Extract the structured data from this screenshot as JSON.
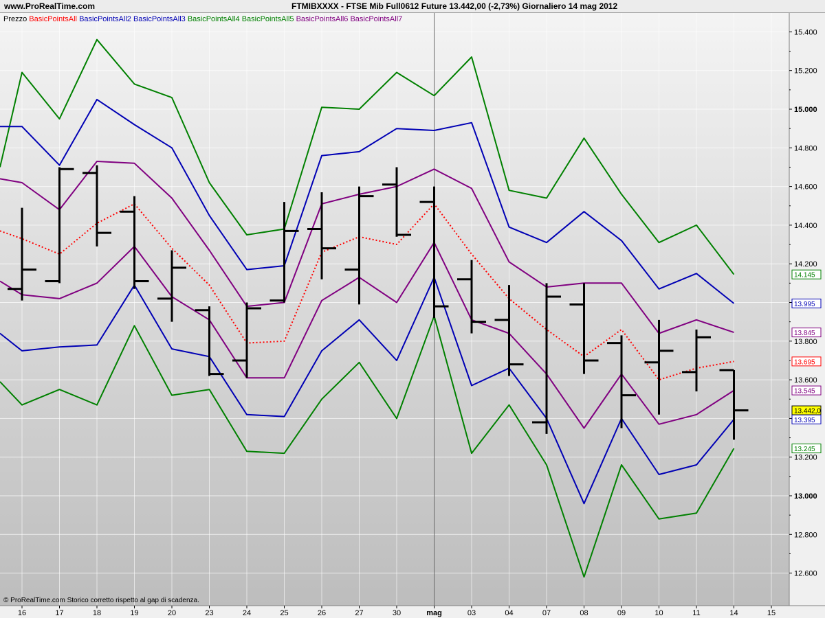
{
  "header": {
    "site": "www.ProRealTime.com",
    "title": "FTMIBXXXX - FTSE Mib Full0612 Future    13.442,00 (-2,73%)    Giornaliero  14 mag 2012"
  },
  "footer": {
    "copyright": "© ProRealTime.com  Storico corretto rispetto al gap di scadenza."
  },
  "chart_data": {
    "type": "line",
    "categories": [
      "16",
      "17",
      "18",
      "19",
      "20",
      "23",
      "24",
      "25",
      "26",
      "27",
      "30",
      "mag",
      "03",
      "04",
      "07",
      "08",
      "09",
      "10",
      "11",
      "14",
      "15"
    ],
    "ylim": [
      12500,
      15500
    ],
    "yticks": [
      12600,
      12800,
      13000,
      13200,
      13400,
      13600,
      13800,
      14000,
      14200,
      14400,
      14600,
      14800,
      15000,
      15200,
      15400
    ],
    "ytick_labels": [
      "12.600",
      "12.800",
      "13.000",
      "13.200",
      "13.400",
      "13.600",
      "13.800",
      "14.000",
      "14.200",
      "14.400",
      "14.600",
      "14.800",
      "15.000",
      "15.200",
      "15.400"
    ],
    "major_ticks": [
      13000,
      15000
    ],
    "grid": true,
    "legend": [
      "Prezzo",
      "BasicPointsAll",
      "BasicPointsAll2",
      "BasicPointsAll3",
      "BasicPointsAll4",
      "BasicPointsAll5",
      "BasicPointsAll6",
      "BasicPointsAll7"
    ],
    "ohlc": {
      "x": [
        "16",
        "17",
        "18",
        "19",
        "20",
        "23",
        "24",
        "25",
        "26",
        "27",
        "30",
        "mag",
        "03",
        "04",
        "07",
        "08",
        "09",
        "10",
        "11",
        "14"
      ],
      "open": [
        14070,
        14110,
        14670,
        14470,
        14020,
        13960,
        13700,
        14010,
        14380,
        14170,
        14610,
        14520,
        14120,
        13910,
        13380,
        13990,
        13790,
        13690,
        13640,
        13650
      ],
      "high": [
        14490,
        14700,
        14710,
        14550,
        14270,
        13980,
        14000,
        14520,
        14570,
        14600,
        14700,
        14600,
        14220,
        14090,
        14100,
        14100,
        13830,
        13910,
        13860,
        13650
      ],
      "low": [
        14010,
        14100,
        14290,
        14070,
        13900,
        13620,
        13610,
        14000,
        14120,
        13990,
        14340,
        13920,
        13840,
        13620,
        13320,
        13630,
        13350,
        13420,
        13540,
        13290
      ],
      "close": [
        14170,
        14690,
        14360,
        14110,
        14180,
        13630,
        13970,
        14370,
        14280,
        14550,
        14350,
        13980,
        13900,
        13680,
        14030,
        13700,
        13520,
        13750,
        13820,
        13442
      ]
    },
    "series": [
      {
        "name": "BasicPointsAll4",
        "color": "#008000",
        "style": "solid",
        "values": [
          15190,
          14950,
          15360,
          15130,
          15060,
          14620,
          14350,
          14380,
          15010,
          15000,
          15190,
          15070,
          15270,
          14580,
          14540,
          14850,
          14560,
          14310,
          14400,
          14145
        ]
      },
      {
        "name": "BasicPointsAll2",
        "color": "#0000b4",
        "style": "solid",
        "values": [
          14910,
          14710,
          15050,
          14920,
          14800,
          14450,
          14170,
          14190,
          14760,
          14780,
          14900,
          14890,
          14930,
          14390,
          14310,
          14470,
          14320,
          14070,
          14150,
          13995
        ]
      },
      {
        "name": "BasicPointsAll6",
        "color": "#800080",
        "style": "solid",
        "values": [
          14620,
          14480,
          14730,
          14720,
          14540,
          14270,
          13980,
          14000,
          14510,
          14560,
          14600,
          14690,
          14590,
          14210,
          14080,
          14100,
          14100,
          13840,
          13910,
          13845
        ]
      },
      {
        "name": "BasicPointsAll",
        "color": "#ff0000",
        "style": "dotted",
        "values": [
          14330,
          14250,
          14410,
          14510,
          14280,
          14090,
          13790,
          13800,
          14260,
          14340,
          14300,
          14510,
          14250,
          14020,
          13860,
          13720,
          13860,
          13600,
          13660,
          13695
        ]
      },
      {
        "name": "BasicPointsAll7",
        "color": "#800080",
        "style": "solid",
        "values": [
          14040,
          14020,
          14100,
          14290,
          14030,
          13910,
          13610,
          13610,
          14010,
          14130,
          14000,
          14310,
          13910,
          13840,
          13630,
          13350,
          13630,
          13370,
          13420,
          13545
        ]
      },
      {
        "name": "BasicPointsAll3",
        "color": "#0000b4",
        "style": "solid",
        "values": [
          13750,
          13770,
          13780,
          14090,
          13760,
          13720,
          13420,
          13410,
          13750,
          13910,
          13700,
          14130,
          13570,
          13660,
          13400,
          12960,
          13400,
          13110,
          13160,
          13395
        ]
      },
      {
        "name": "BasicPointsAll5",
        "color": "#008000",
        "style": "solid",
        "values": [
          13470,
          13550,
          13470,
          13880,
          13520,
          13550,
          13230,
          13220,
          13500,
          13690,
          13400,
          13930,
          13220,
          13470,
          13160,
          12580,
          13160,
          12880,
          12910,
          13245
        ]
      }
    ],
    "first_point": [
      14700,
      14910,
      14640,
      14370,
      14110,
      13840,
      13590
    ],
    "value_badges": [
      {
        "label": "14.145",
        "value": 14145,
        "color": "#008000"
      },
      {
        "label": "13.995",
        "value": 13995,
        "color": "#0000b4"
      },
      {
        "label": "13.845",
        "value": 13845,
        "color": "#800080"
      },
      {
        "label": "13.695",
        "value": 13695,
        "color": "#ff0000"
      },
      {
        "label": "13.545",
        "value": 13545,
        "color": "#800080"
      },
      {
        "label": "13.442,0",
        "value": 13442,
        "color": "#000000",
        "bg": "#ffff00"
      },
      {
        "label": "13.395",
        "value": 13395,
        "color": "#0000b4"
      },
      {
        "label": "13.245",
        "value": 13245,
        "color": "#008000"
      }
    ],
    "legend_colors": [
      "#000000",
      "#ff0000",
      "#0000b4",
      "#0000b4",
      "#008000",
      "#008000",
      "#800080",
      "#800080"
    ],
    "price_color": "#000000"
  }
}
